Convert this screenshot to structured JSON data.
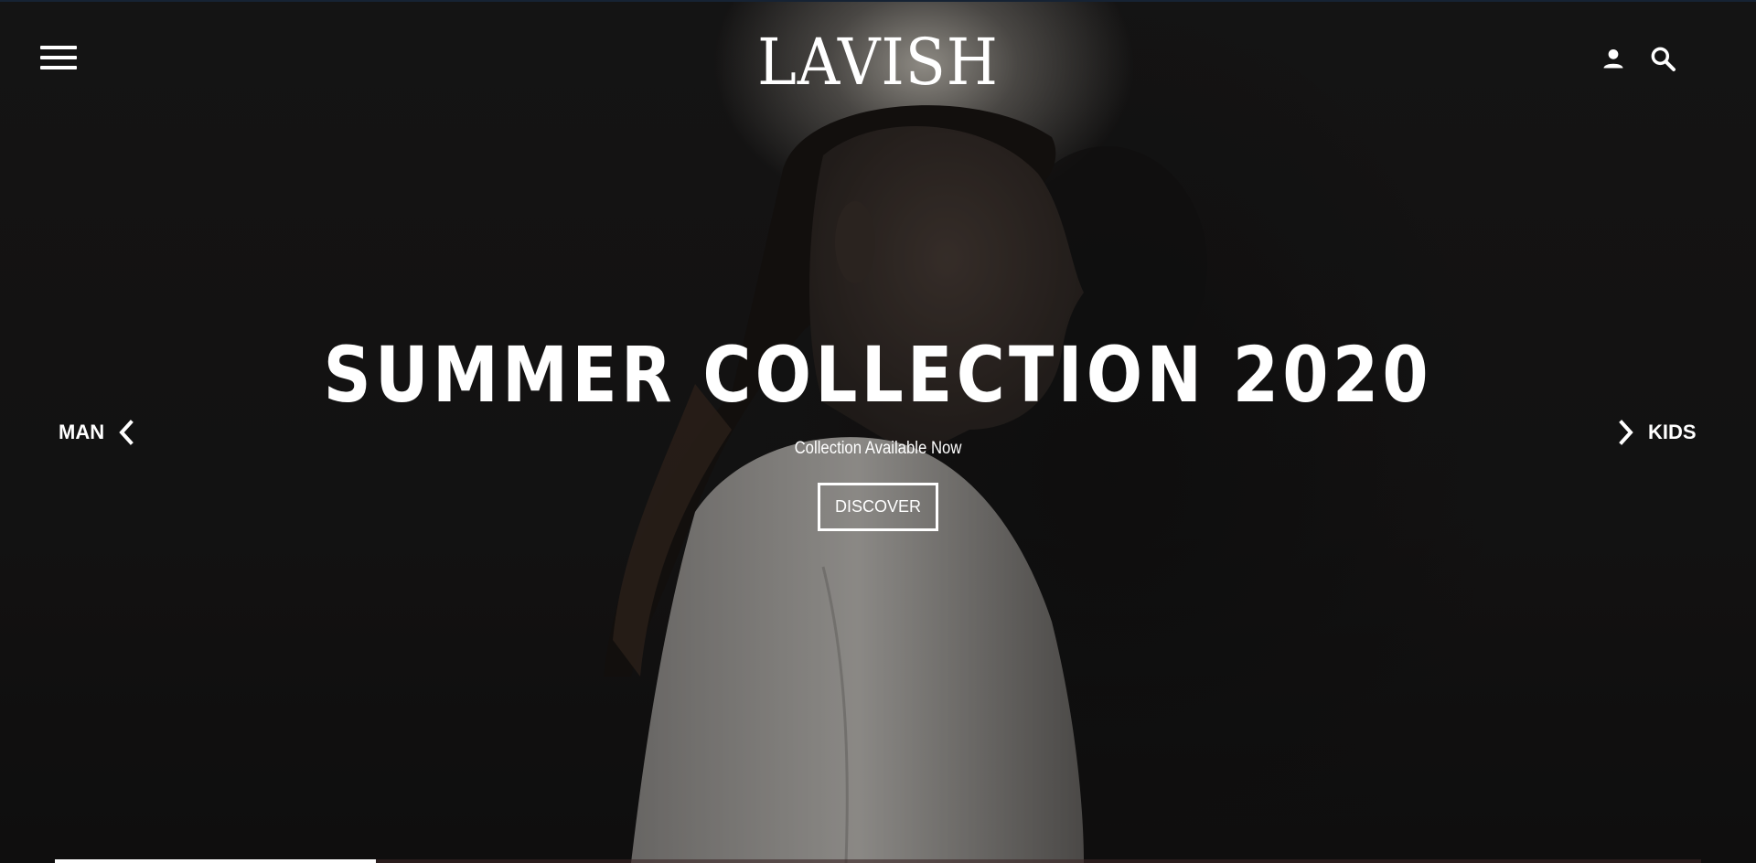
{
  "header": {
    "logo": "LAVISH"
  },
  "hero": {
    "title": "SUMMER COLLECTION 2020",
    "subtitle": "Collection Available Now",
    "cta_label": "DISCOVER"
  },
  "nav": {
    "prev_label": "MAN",
    "next_label": "KIDS"
  },
  "slideshow": {
    "progress_fraction": 0.195
  },
  "icons": {
    "menu": "hamburger-menu-icon",
    "user": "user-icon",
    "search": "search-icon",
    "prev": "chevron-left-icon",
    "next": "chevron-right-icon"
  },
  "colors": {
    "background": "#1b1a1a",
    "text": "#ffffff"
  }
}
